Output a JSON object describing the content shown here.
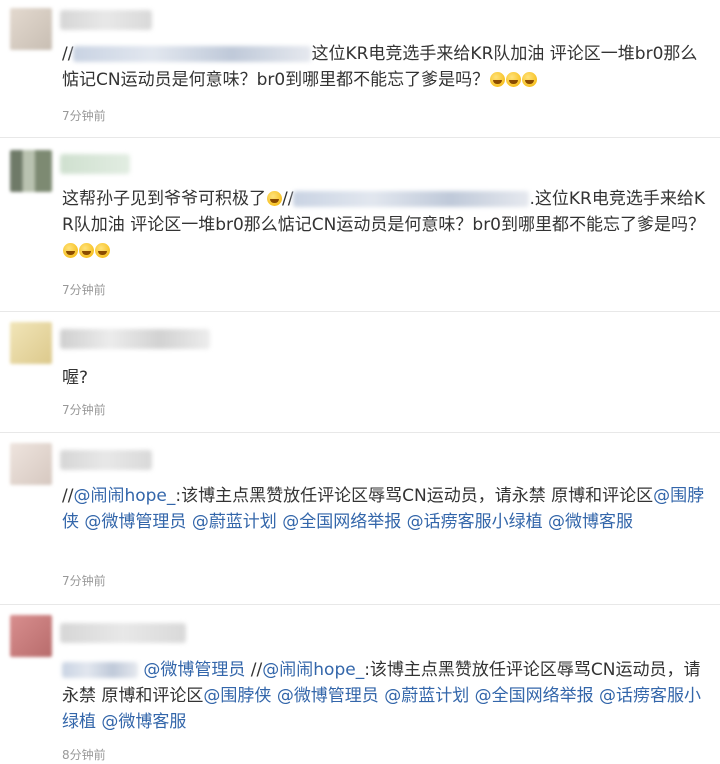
{
  "comments": [
    {
      "avatar_color": "#d8cfc6",
      "prefix": "//",
      "text": "这位KR电竞选手来给KR队加油 评论区一堆br0那么惦记CN运动员是何意味？br0到哪里都不能忘了爹是吗？",
      "emoji": [
        "laughing-icon",
        "laughing-icon",
        "laughing-icon"
      ],
      "time": "7分钟前"
    },
    {
      "avatar_color": "#8f9a86",
      "text_a": "这帮孙子见到爷爷可积极了",
      "prefix": "//",
      "text_b": ".这位KR电竞选手来给KR队加油 评论区一堆br0那么惦记CN运动员是何意味？br0到哪里都不能忘了爹是吗？",
      "emoji": [
        "laughing-icon",
        "laughing-icon",
        "laughing-icon"
      ],
      "time": "7分钟前"
    },
    {
      "avatar_color": "#e9dcae",
      "text": "喔?",
      "time": "7分钟前"
    },
    {
      "avatar_color": "#e3d6cf",
      "prefix": "//",
      "mention": "@闹闹hope_",
      "text_a": ":该博主点黑赞放任评论区辱骂CN运动员，请永禁 原博和评论区",
      "mentions": [
        "@围脖侠",
        "@微博管理员",
        "@蔚蓝计划",
        "@全国网络举报",
        "@话痨客服小绿植",
        "@微博客服"
      ],
      "time": "7分钟前"
    },
    {
      "avatar_color": "#c97f7f",
      "mention_a": "@微博管理员",
      "prefix": " //",
      "mention_b": "@闹闹hope_",
      "text_a": ":该博主点黑赞放任评论区辱骂CN运动员，请永禁 原博和评论区",
      "mentions": [
        "@围脖侠",
        "@微博管理员",
        "@蔚蓝计划",
        "@全国网络举报",
        "@话痨客服小绿植",
        "@微博客服"
      ],
      "time": "8分钟前"
    }
  ]
}
